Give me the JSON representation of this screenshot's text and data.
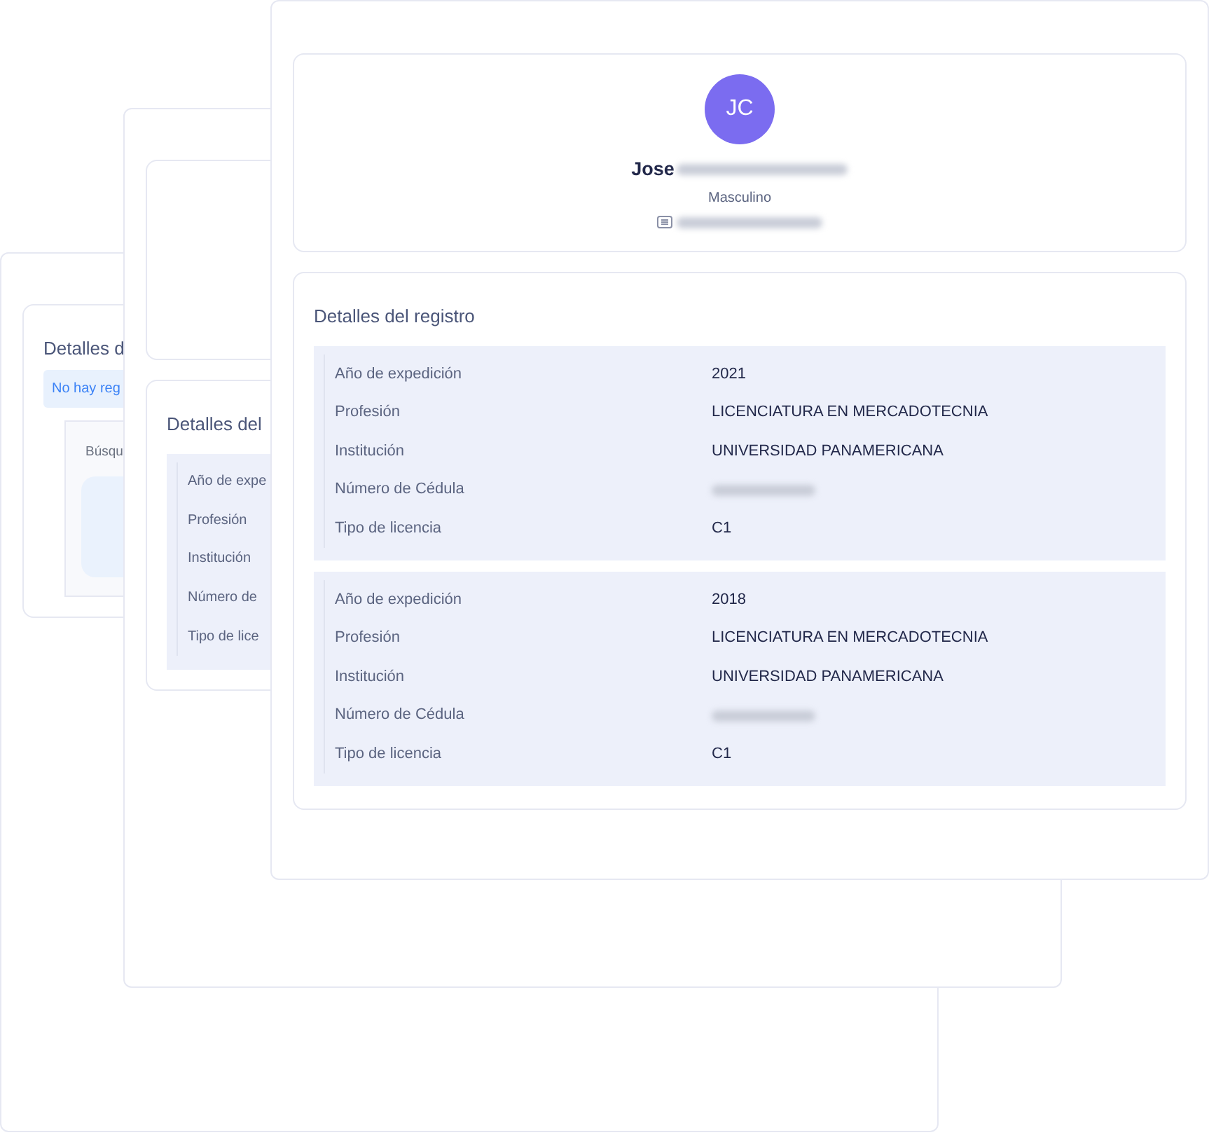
{
  "back_card": {
    "section_title": "Detalles d",
    "notice": "No hay reg",
    "search_label": "Búsqu"
  },
  "middle_card": {
    "section_title": "Detalles del",
    "rows": [
      {
        "label": "Año de expe"
      },
      {
        "label": "Profesión"
      },
      {
        "label": "Institución"
      },
      {
        "label": "Número de"
      },
      {
        "label": "Tipo de lice"
      }
    ]
  },
  "front_card": {
    "avatar": "JC",
    "name": "Jose",
    "gender": "Masculino",
    "section_title": "Detalles del registro",
    "records": [
      {
        "fields": [
          {
            "label": "Año de expedición",
            "value": "2021"
          },
          {
            "label": "Profesión",
            "value": "LICENCIATURA EN MERCADOTECNIA"
          },
          {
            "label": "Institución",
            "value": "UNIVERSIDAD PANAMERICANA"
          },
          {
            "label": "Número de Cédula"
          },
          {
            "label": "Tipo de licencia",
            "value": "C1"
          }
        ]
      },
      {
        "fields": [
          {
            "label": "Año de expedición",
            "value": "2018"
          },
          {
            "label": "Profesión",
            "value": "LICENCIATURA EN MERCADOTECNIA"
          },
          {
            "label": "Institución",
            "value": "UNIVERSIDAD PANAMERICANA"
          },
          {
            "label": "Número de Cédula"
          },
          {
            "label": "Tipo de licencia",
            "value": "C1"
          }
        ]
      }
    ]
  }
}
